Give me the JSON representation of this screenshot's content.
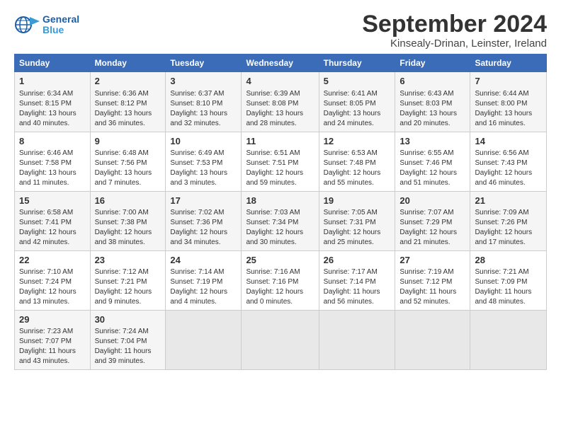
{
  "logo": {
    "line1": "General",
    "line2": "Blue"
  },
  "title": "September 2024",
  "location": "Kinsealy-Drinan, Leinster, Ireland",
  "days_header": [
    "Sunday",
    "Monday",
    "Tuesday",
    "Wednesday",
    "Thursday",
    "Friday",
    "Saturday"
  ],
  "weeks": [
    [
      {
        "day": "1",
        "info": "Sunrise: 6:34 AM\nSunset: 8:15 PM\nDaylight: 13 hours\nand 40 minutes."
      },
      {
        "day": "2",
        "info": "Sunrise: 6:36 AM\nSunset: 8:12 PM\nDaylight: 13 hours\nand 36 minutes."
      },
      {
        "day": "3",
        "info": "Sunrise: 6:37 AM\nSunset: 8:10 PM\nDaylight: 13 hours\nand 32 minutes."
      },
      {
        "day": "4",
        "info": "Sunrise: 6:39 AM\nSunset: 8:08 PM\nDaylight: 13 hours\nand 28 minutes."
      },
      {
        "day": "5",
        "info": "Sunrise: 6:41 AM\nSunset: 8:05 PM\nDaylight: 13 hours\nand 24 minutes."
      },
      {
        "day": "6",
        "info": "Sunrise: 6:43 AM\nSunset: 8:03 PM\nDaylight: 13 hours\nand 20 minutes."
      },
      {
        "day": "7",
        "info": "Sunrise: 6:44 AM\nSunset: 8:00 PM\nDaylight: 13 hours\nand 16 minutes."
      }
    ],
    [
      {
        "day": "8",
        "info": "Sunrise: 6:46 AM\nSunset: 7:58 PM\nDaylight: 13 hours\nand 11 minutes."
      },
      {
        "day": "9",
        "info": "Sunrise: 6:48 AM\nSunset: 7:56 PM\nDaylight: 13 hours\nand 7 minutes."
      },
      {
        "day": "10",
        "info": "Sunrise: 6:49 AM\nSunset: 7:53 PM\nDaylight: 13 hours\nand 3 minutes."
      },
      {
        "day": "11",
        "info": "Sunrise: 6:51 AM\nSunset: 7:51 PM\nDaylight: 12 hours\nand 59 minutes."
      },
      {
        "day": "12",
        "info": "Sunrise: 6:53 AM\nSunset: 7:48 PM\nDaylight: 12 hours\nand 55 minutes."
      },
      {
        "day": "13",
        "info": "Sunrise: 6:55 AM\nSunset: 7:46 PM\nDaylight: 12 hours\nand 51 minutes."
      },
      {
        "day": "14",
        "info": "Sunrise: 6:56 AM\nSunset: 7:43 PM\nDaylight: 12 hours\nand 46 minutes."
      }
    ],
    [
      {
        "day": "15",
        "info": "Sunrise: 6:58 AM\nSunset: 7:41 PM\nDaylight: 12 hours\nand 42 minutes."
      },
      {
        "day": "16",
        "info": "Sunrise: 7:00 AM\nSunset: 7:38 PM\nDaylight: 12 hours\nand 38 minutes."
      },
      {
        "day": "17",
        "info": "Sunrise: 7:02 AM\nSunset: 7:36 PM\nDaylight: 12 hours\nand 34 minutes."
      },
      {
        "day": "18",
        "info": "Sunrise: 7:03 AM\nSunset: 7:34 PM\nDaylight: 12 hours\nand 30 minutes."
      },
      {
        "day": "19",
        "info": "Sunrise: 7:05 AM\nSunset: 7:31 PM\nDaylight: 12 hours\nand 25 minutes."
      },
      {
        "day": "20",
        "info": "Sunrise: 7:07 AM\nSunset: 7:29 PM\nDaylight: 12 hours\nand 21 minutes."
      },
      {
        "day": "21",
        "info": "Sunrise: 7:09 AM\nSunset: 7:26 PM\nDaylight: 12 hours\nand 17 minutes."
      }
    ],
    [
      {
        "day": "22",
        "info": "Sunrise: 7:10 AM\nSunset: 7:24 PM\nDaylight: 12 hours\nand 13 minutes."
      },
      {
        "day": "23",
        "info": "Sunrise: 7:12 AM\nSunset: 7:21 PM\nDaylight: 12 hours\nand 9 minutes."
      },
      {
        "day": "24",
        "info": "Sunrise: 7:14 AM\nSunset: 7:19 PM\nDaylight: 12 hours\nand 4 minutes."
      },
      {
        "day": "25",
        "info": "Sunrise: 7:16 AM\nSunset: 7:16 PM\nDaylight: 12 hours\nand 0 minutes."
      },
      {
        "day": "26",
        "info": "Sunrise: 7:17 AM\nSunset: 7:14 PM\nDaylight: 11 hours\nand 56 minutes."
      },
      {
        "day": "27",
        "info": "Sunrise: 7:19 AM\nSunset: 7:12 PM\nDaylight: 11 hours\nand 52 minutes."
      },
      {
        "day": "28",
        "info": "Sunrise: 7:21 AM\nSunset: 7:09 PM\nDaylight: 11 hours\nand 48 minutes."
      }
    ],
    [
      {
        "day": "29",
        "info": "Sunrise: 7:23 AM\nSunset: 7:07 PM\nDaylight: 11 hours\nand 43 minutes."
      },
      {
        "day": "30",
        "info": "Sunrise: 7:24 AM\nSunset: 7:04 PM\nDaylight: 11 hours\nand 39 minutes."
      },
      {
        "day": "",
        "info": ""
      },
      {
        "day": "",
        "info": ""
      },
      {
        "day": "",
        "info": ""
      },
      {
        "day": "",
        "info": ""
      },
      {
        "day": "",
        "info": ""
      }
    ]
  ]
}
